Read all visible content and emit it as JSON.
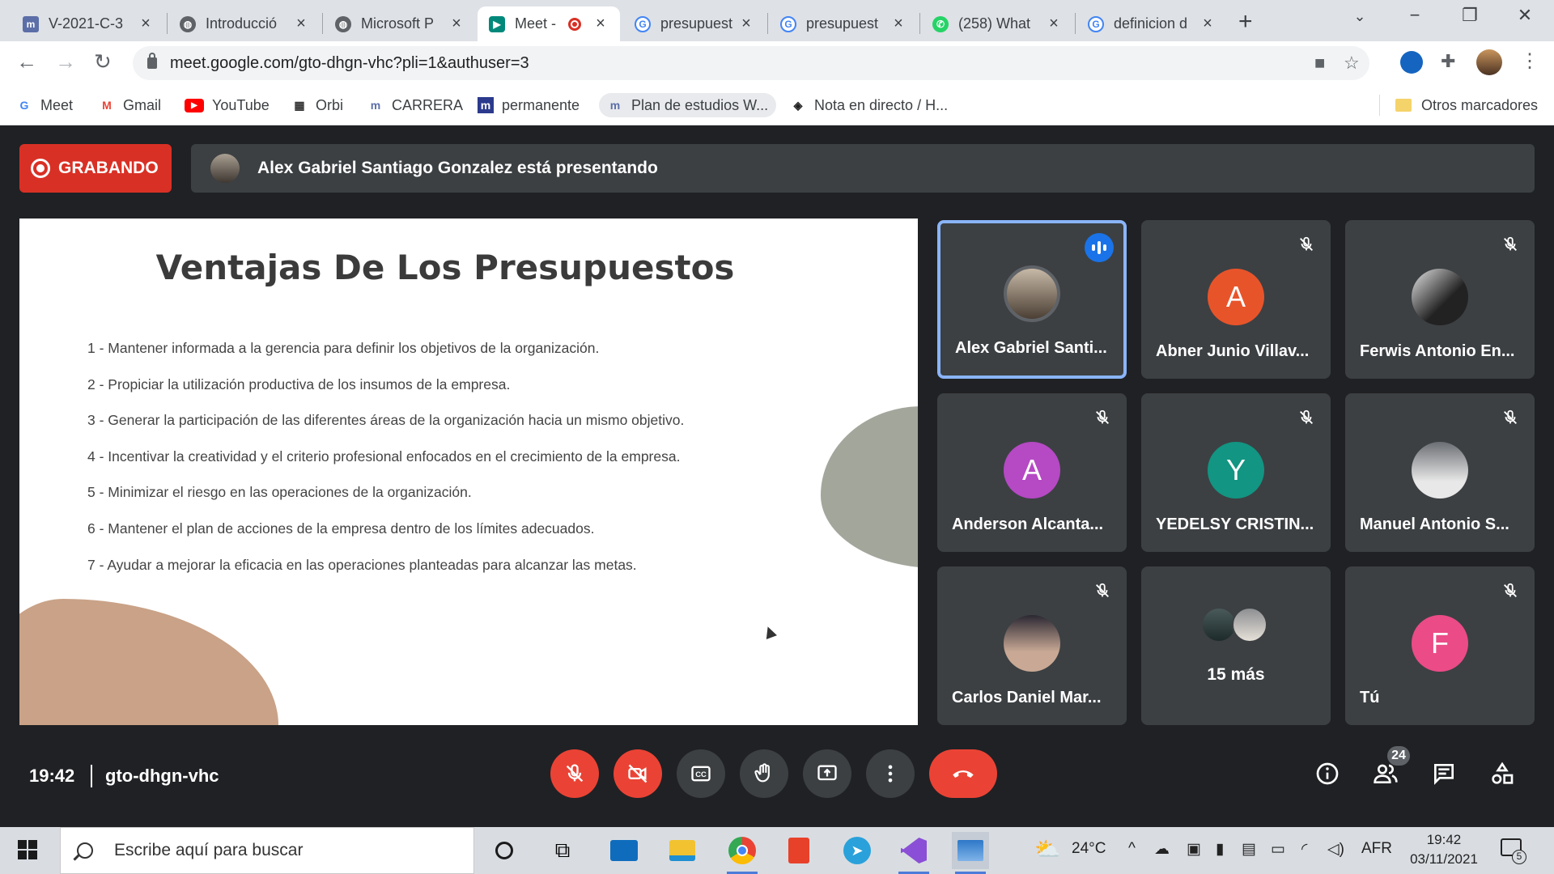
{
  "browser": {
    "tabs": [
      {
        "title": "V-2021-C-3",
        "icon": "university-icon",
        "color": "#5b6ea8"
      },
      {
        "title": "Introducció",
        "icon": "globe-icon",
        "color": "#5f6368"
      },
      {
        "title": "Microsoft P",
        "icon": "globe-icon",
        "color": "#5f6368"
      },
      {
        "title": "Meet -",
        "icon": "meet-icon",
        "color": "#00897b"
      },
      {
        "title": "presupuest",
        "icon": "google-icon",
        "color": "#4285f4"
      },
      {
        "title": "presupuest",
        "icon": "google-icon",
        "color": "#4285f4"
      },
      {
        "title": "(258) What",
        "icon": "whatsapp-icon",
        "color": "#25d366"
      },
      {
        "title": "definicion d",
        "icon": "google-icon",
        "color": "#4285f4"
      }
    ],
    "url": "meet.google.com/gto-dhgn-vhc?pli=1&authuser=3",
    "bookmarks": [
      {
        "label": "Meet",
        "icon": "google-icon"
      },
      {
        "label": "Gmail",
        "icon": "gmail-icon"
      },
      {
        "label": "YouTube",
        "icon": "youtube-icon"
      },
      {
        "label": "Orbi",
        "icon": "orbi-icon"
      },
      {
        "label": "CARRERA",
        "icon": "university-icon"
      },
      {
        "label": "permanente",
        "icon": "university-icon"
      },
      {
        "label": "Plan de estudios W...",
        "icon": "university-icon"
      },
      {
        "label": "Nota en directo / H...",
        "icon": "codepen-icon"
      }
    ],
    "other_bookmarks": "Otros marcadores"
  },
  "meet": {
    "recording_label": "GRABANDO",
    "presenter_banner": "Alex Gabriel Santiago Gonzalez está presentando",
    "slide": {
      "title": "Ventajas De Los Presupuestos",
      "items": [
        "1 - Mantener informada a la gerencia para definir los objetivos de la organización.",
        "2 - Propiciar la utilización productiva de los insumos de la empresa.",
        "3 - Generar la participación de las diferentes áreas de la organización hacia un mismo objetivo.",
        "4 - Incentivar la creatividad y el criterio profesional enfocados en el crecimiento de la empresa.",
        "5 - Minimizar el riesgo en las operaciones de la organización.",
        "6 - Mantener el plan de acciones de la empresa dentro de los límites adecuados.",
        "7 - Ayudar a mejorar la eficacia en las operaciones planteadas para alcanzar las metas."
      ]
    },
    "participants": [
      {
        "name": "Alex Gabriel Santi...",
        "initial": "",
        "color": "#6d6257",
        "speaking": true
      },
      {
        "name": "Abner Junio Villav...",
        "initial": "A",
        "color": "#e8542a",
        "speaking": false
      },
      {
        "name": "Ferwis Antonio En...",
        "initial": "",
        "color": "#4a4a4a",
        "speaking": false
      },
      {
        "name": "Anderson Alcanta...",
        "initial": "A",
        "color": "#b649c4",
        "speaking": false
      },
      {
        "name": "YEDELSY CRISTIN...",
        "initial": "Y",
        "color": "#129582",
        "speaking": false
      },
      {
        "name": "Manuel Antonio S...",
        "initial": "",
        "color": "#5c5f63",
        "speaking": false
      },
      {
        "name": "Carlos Daniel Mar...",
        "initial": "",
        "color": "#3d3a45",
        "speaking": false
      },
      {
        "name": "",
        "initial": "",
        "color": "#3c4043",
        "speaking": false,
        "more": "15 más"
      },
      {
        "name": "Tú",
        "initial": "F",
        "color": "#eb4b87",
        "speaking": false
      }
    ],
    "time": "19:42",
    "meeting_code": "gto-dhgn-vhc",
    "people_count": "24"
  },
  "taskbar": {
    "search_placeholder": "Escribe aquí para buscar",
    "weather": "24°C",
    "language": "AFR",
    "time": "19:42",
    "date": "03/11/2021",
    "notifications": "5"
  }
}
